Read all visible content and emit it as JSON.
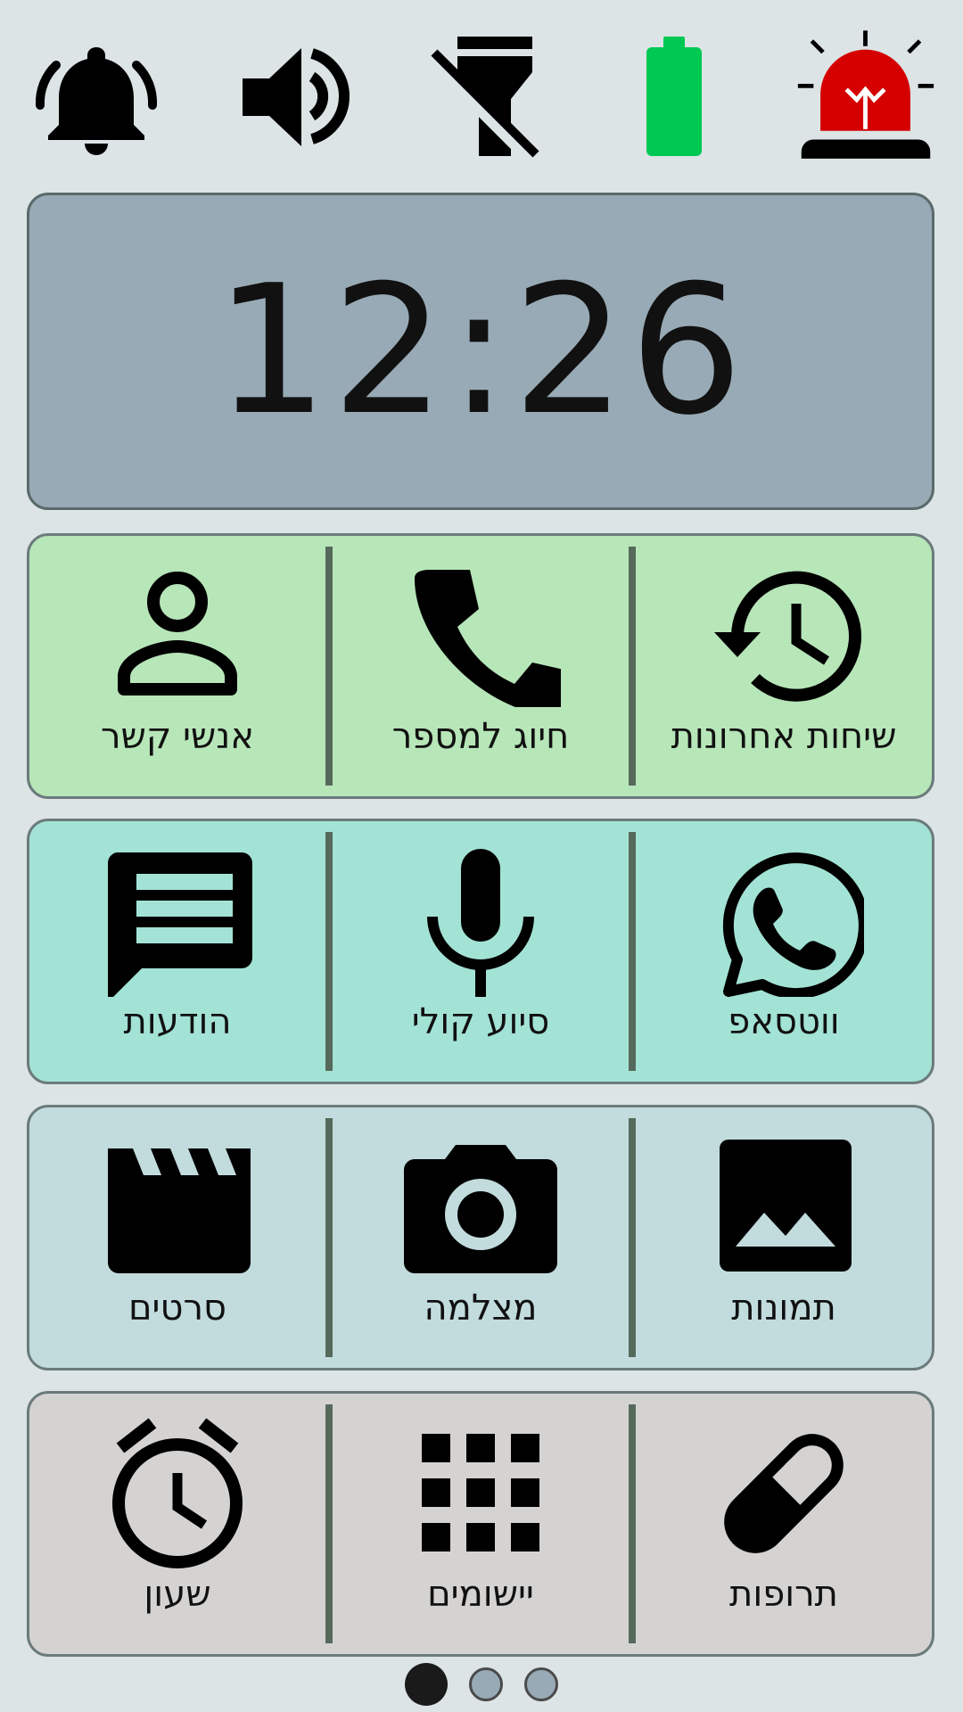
{
  "status_bar": {
    "icons": [
      "bell-icon",
      "volume-icon",
      "flashlight-off-icon",
      "battery-icon",
      "emergency-siren-icon"
    ],
    "battery_level": 1.0,
    "colors": {
      "battery": "#00c853",
      "siren": "#d50000"
    }
  },
  "clock": {
    "time": "12:26"
  },
  "rows": [
    {
      "tiles": [
        {
          "label": "שיחות אחרונות",
          "icon": "history-icon"
        },
        {
          "label": "חיוג למספר",
          "icon": "phone-icon"
        },
        {
          "label": "אנשי קשר",
          "icon": "contact-icon"
        }
      ]
    },
    {
      "tiles": [
        {
          "label": "ווטסאפ",
          "icon": "whatsapp-icon"
        },
        {
          "label": "סיוע קולי",
          "icon": "microphone-icon"
        },
        {
          "label": "הודעות",
          "icon": "message-icon"
        }
      ]
    },
    {
      "tiles": [
        {
          "label": "תמונות",
          "icon": "image-icon"
        },
        {
          "label": "מצלמה",
          "icon": "camera-icon"
        },
        {
          "label": "סרטים",
          "icon": "clapperboard-icon"
        }
      ]
    },
    {
      "tiles": [
        {
          "label": "תרופות",
          "icon": "pill-icon"
        },
        {
          "label": "יישומים",
          "icon": "apps-grid-icon"
        },
        {
          "label": "שעון",
          "icon": "alarm-clock-icon"
        }
      ]
    }
  ],
  "pager": {
    "current_page": 1,
    "total_pages": 3
  }
}
